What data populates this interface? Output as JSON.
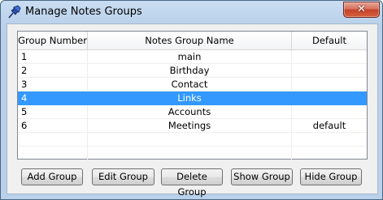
{
  "window": {
    "title": "Manage Notes Groups",
    "close_label": "✕"
  },
  "table": {
    "columns": [
      "Group Number",
      "Notes Group Name",
      "Default"
    ],
    "rows": [
      {
        "number": "1",
        "name": "main",
        "default": ""
      },
      {
        "number": "2",
        "name": "Birthday",
        "default": ""
      },
      {
        "number": "3",
        "name": "Contact",
        "default": ""
      },
      {
        "number": "4",
        "name": "Links",
        "default": "",
        "selected": true
      },
      {
        "number": "5",
        "name": "Accounts",
        "default": ""
      },
      {
        "number": "6",
        "name": "Meetings",
        "default": "default"
      }
    ]
  },
  "buttons": {
    "add": "Add Group",
    "edit": "Edit Group",
    "delete": "Delete Group",
    "show": "Show Group",
    "hide": "Hide Group"
  },
  "colors": {
    "selection": "#3399ff",
    "close_button": "#c6412b"
  }
}
